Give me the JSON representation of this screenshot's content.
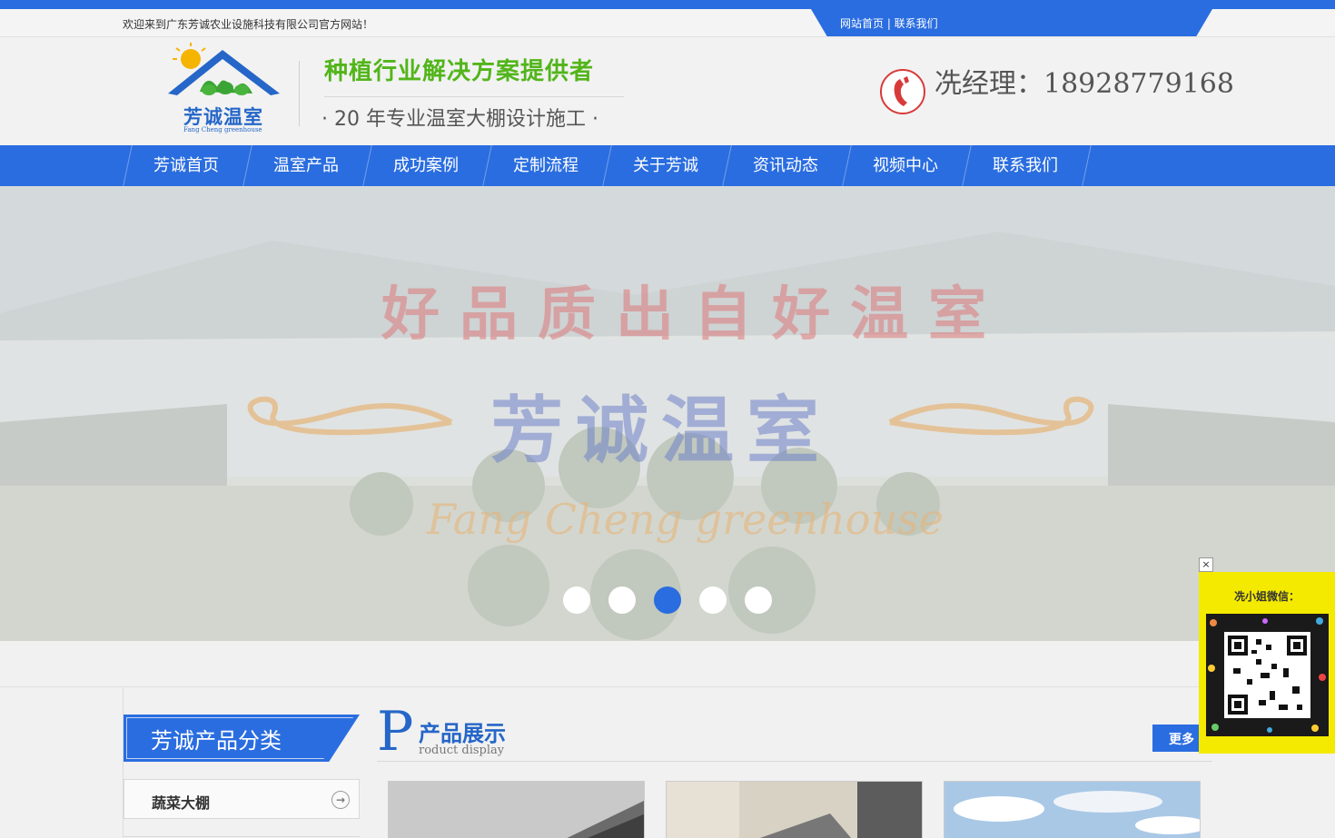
{
  "topbar": {
    "welcome": "欢迎来到广东芳诚农业设施科技有限公司官方网站！",
    "links": "网站首页 | 联系我们"
  },
  "header": {
    "logo_text": "芳诚温室",
    "logo_sub": "Fang Cheng greenhouse",
    "slogan1": "种植行业解决方案提供者",
    "slogan2": "· 20 年专业温室大棚设计施工 ·",
    "phone": "冼经理：18928779168"
  },
  "nav": {
    "items": [
      "芳诚首页",
      "温室产品",
      "成功案例",
      "定制流程",
      "关于芳诚",
      "资讯动态",
      "视频中心",
      "联系我们"
    ]
  },
  "banner": {
    "title1": "好品质出自好温室",
    "title2": "芳诚温室",
    "title3": "Fang Cheng greenhouse",
    "slide_count": 5,
    "active_slide": 3
  },
  "sidebar": {
    "title": "芳诚产品分类",
    "items": [
      {
        "label": "蔬菜大棚"
      }
    ]
  },
  "products": {
    "letter": "P",
    "title": "产品展示",
    "subtitle": "roduct display",
    "more": "更多"
  },
  "qr": {
    "label": "冼小姐微信：",
    "close": "×"
  },
  "colors": {
    "brand_blue": "#2a6de0",
    "slogan_green": "#52b51a",
    "qr_yellow": "#f3ea00"
  }
}
